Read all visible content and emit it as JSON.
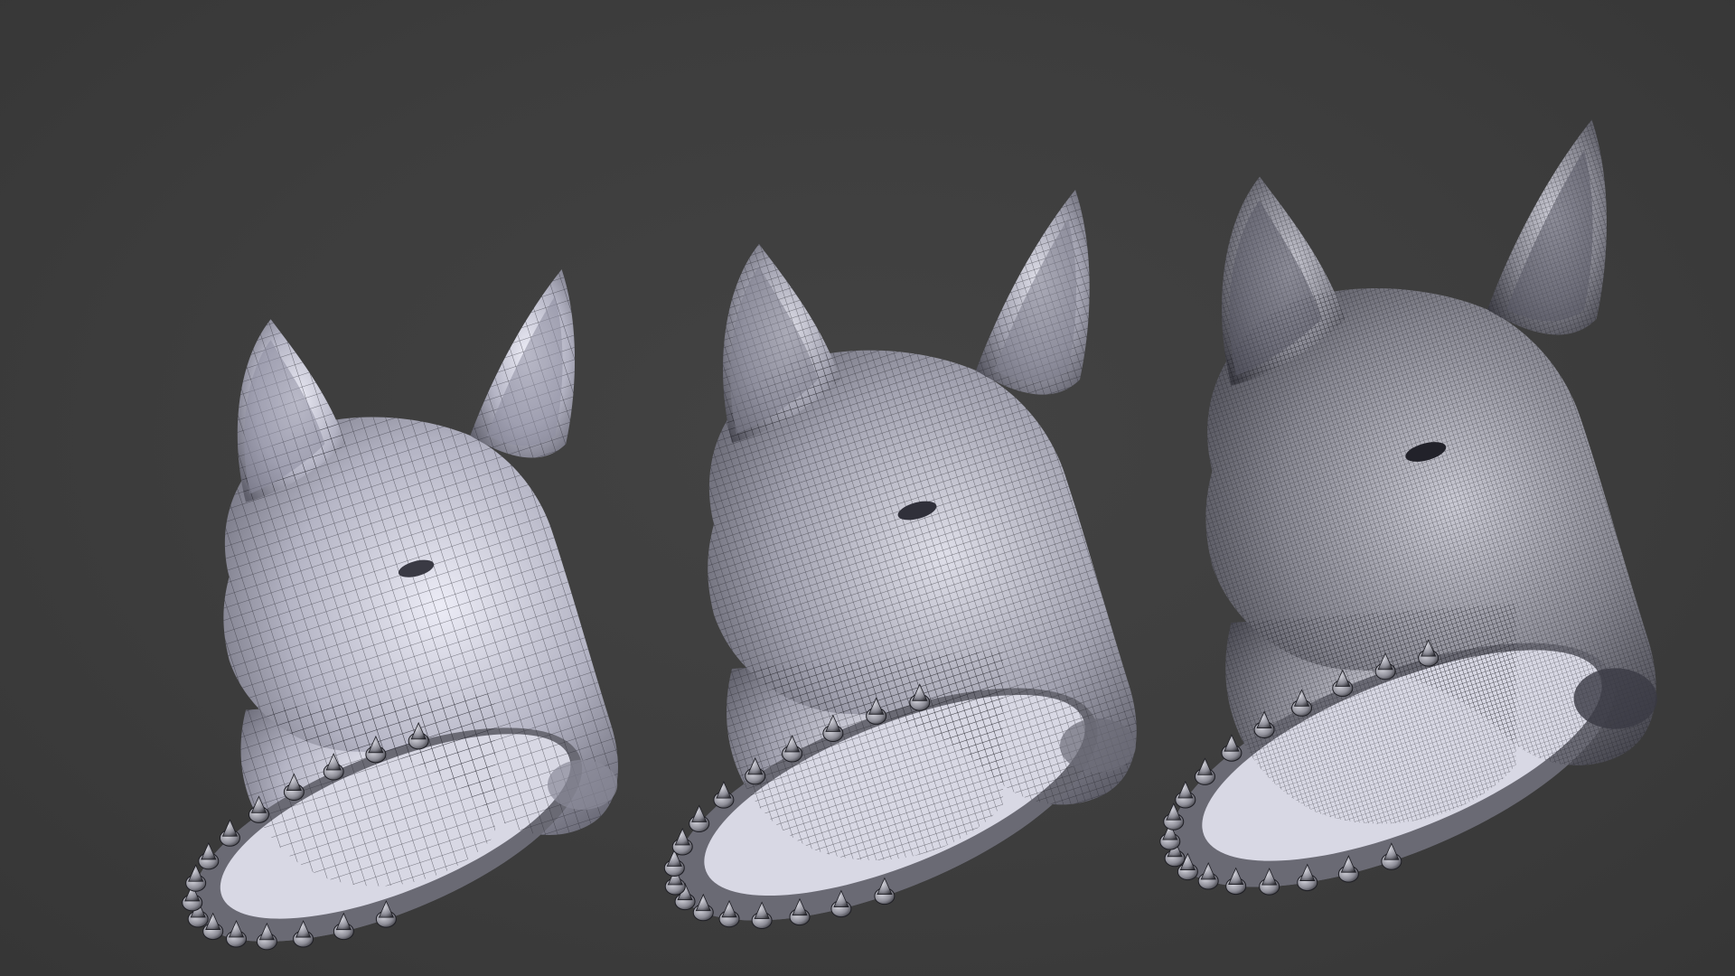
{
  "scene": {
    "background_color": "#3c3c3c",
    "models": [
      {
        "name": "bull-terrier-head-low-density",
        "mesh_density": "low",
        "shade_light": "#e4e4f0",
        "shade_mid": "#a9a9b8",
        "shade_dark": "#55555f",
        "wire_color": "#2a2a32"
      },
      {
        "name": "bull-terrier-head-medium-density",
        "mesh_density": "medium",
        "shade_light": "#d6d6e2",
        "shade_mid": "#9a9aa8",
        "shade_dark": "#4a4a54",
        "wire_color": "#24242b"
      },
      {
        "name": "bull-terrier-head-high-density",
        "mesh_density": "high",
        "shade_light": "#c2c2cc",
        "shade_mid": "#7e7e88",
        "shade_dark": "#3a3a42",
        "wire_color": "#1c1c22"
      }
    ],
    "collar_spike_color": "#9c9ca6"
  }
}
